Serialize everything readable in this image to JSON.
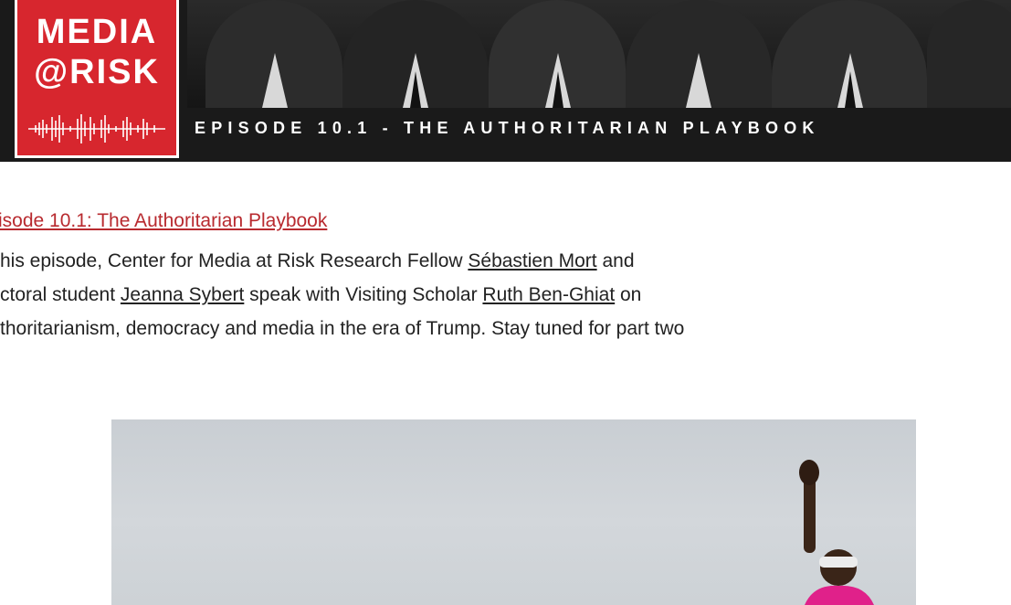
{
  "banner": {
    "logo_line1": "MEDIA",
    "logo_line2": "@RISK",
    "episode_caption": "EPISODE 10.1 - THE AUTHORITARIAN PLAYBOOK"
  },
  "article": {
    "title_link": "isode 10.1: The Authoritarian Playbook ",
    "line1": {
      "pre": "his episode, Center for Media at Risk Research Fellow ",
      "link1": "Sébastien Mort",
      "post": " and"
    },
    "line2": {
      "pre": "ctoral student ",
      "link1": "Jeanna Sybert",
      "mid": " speak with Visiting Scholar ",
      "link2": "Ruth Ben-Ghiat",
      "post": " on"
    },
    "line3": "thoritarianism, democracy and media in the era of Trump. Stay tuned for part two"
  },
  "colors": {
    "brand_red": "#d7262e",
    "link_red": "#b82a2f",
    "banner_dark": "#1a1a1a",
    "body_text": "#222222"
  }
}
